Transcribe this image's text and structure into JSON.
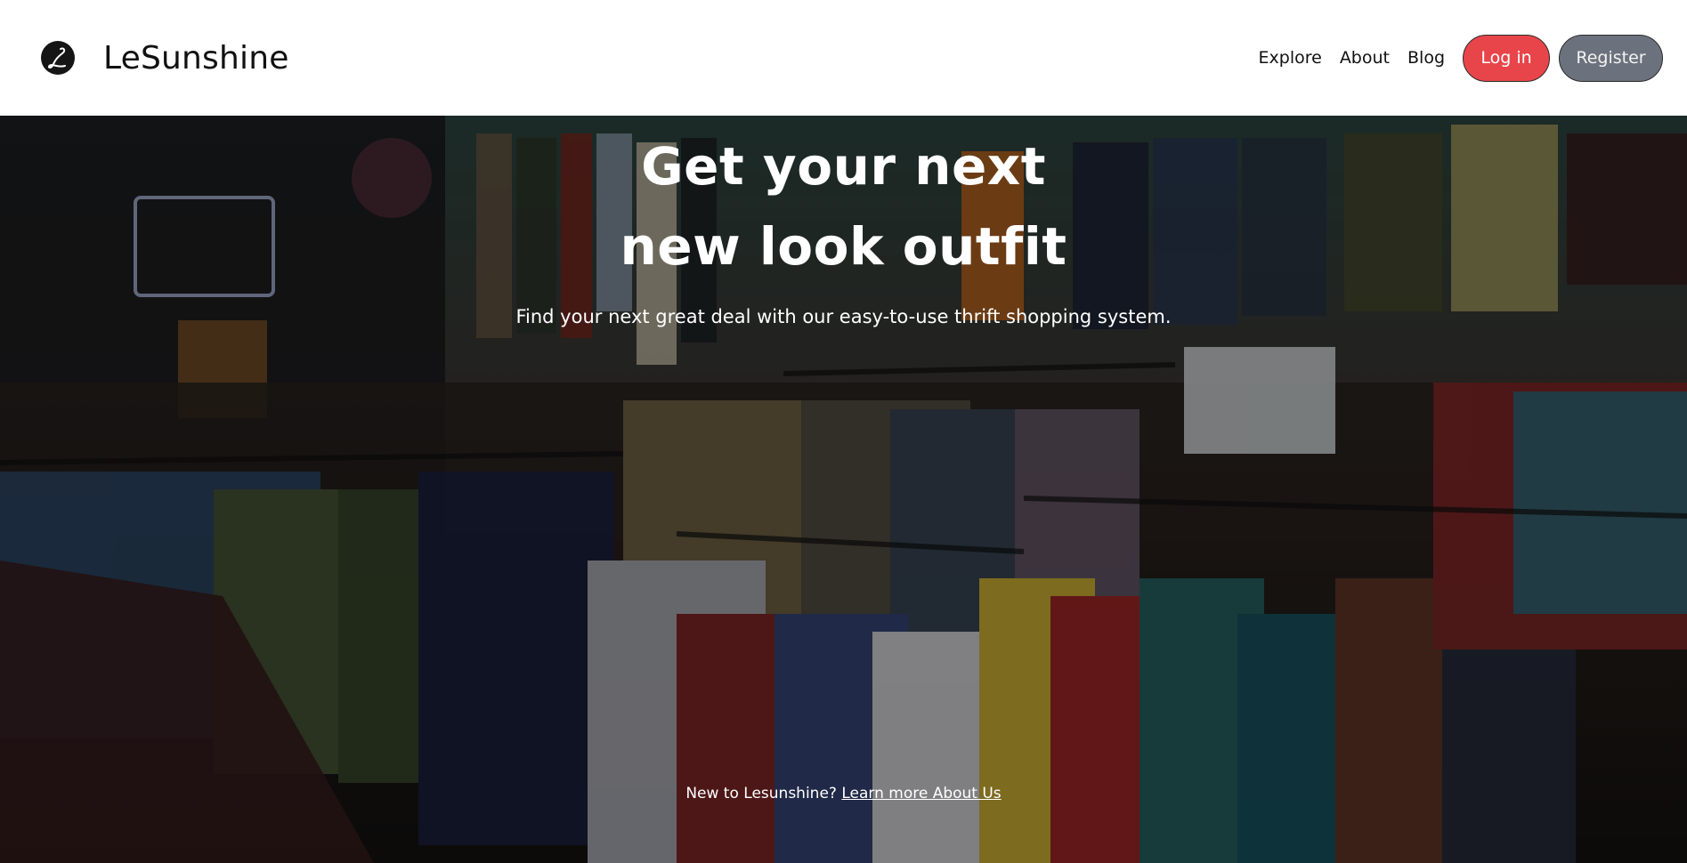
{
  "brand": {
    "name": "LeSunshine",
    "logo_icon": "script-l-monogram-icon"
  },
  "nav": {
    "links": [
      {
        "label": "Explore"
      },
      {
        "label": "About"
      },
      {
        "label": "Blog"
      }
    ],
    "login_label": "Log in",
    "register_label": "Register"
  },
  "hero": {
    "title_line1": "Get your next",
    "title_line2": "new look outfit",
    "subtitle": "Find your next great deal with our easy-to-use thrift shopping system.",
    "footer_prefix": "New to Lesunshine? ",
    "footer_link": "Learn more About Us"
  },
  "colors": {
    "login_bg": "#e8454a",
    "register_bg": "#6c727d",
    "header_bg": "#ffffff"
  }
}
